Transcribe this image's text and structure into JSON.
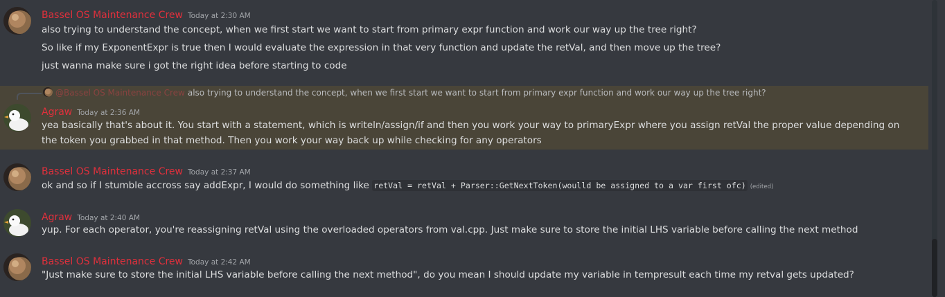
{
  "messages": [
    {
      "author": "Bassel OS Maintenance Crew",
      "timestamp": "Today at 2:30 AM",
      "lines": [
        "also trying to understand the concept, when we first start we want to start from primary expr function and work our way up the tree right?",
        "So like if my ExponentExpr is true then I would evaluate the expression in that very function and update the retVal, and then move up the tree?",
        "just wanna make sure i got the right idea before starting to code"
      ]
    },
    {
      "reply": {
        "mention": "@Bassel OS Maintenance Crew",
        "text": "also trying to understand the concept, when we first start we want to start from primary expr function and work our way up the tree right?"
      },
      "author": "Agraw",
      "timestamp": "Today at 2:36 AM",
      "text": "yea basically that's about it. You start with a statement, which is writeln/assign/if and then you work your way to primaryExpr where you assign retVal the proper value depending on the token you grabbed in that method. Then you work your way back up while checking for any operators"
    },
    {
      "author": "Bassel OS Maintenance Crew",
      "timestamp": "Today at 2:37 AM",
      "text_before": "ok and so if I stumble accross say addExpr, I would do something like ",
      "code": "retVal = retVal + Parser::GetNextToken(woulld be assigned to a var first ofc)",
      "edited": "(edited)"
    },
    {
      "author": "Agraw",
      "timestamp": "Today at 2:40 AM",
      "text": "yup. For each operator, you're reassigning retVal using the overloaded operators from val.cpp. Just make sure to store the initial LHS variable before calling the next method"
    },
    {
      "author": "Bassel OS Maintenance Crew",
      "timestamp": "Today at 2:42 AM",
      "text": "\"Just make sure to store the initial LHS variable before calling the next method\", do you mean I should update my variable in tempresult each time my retval gets updated?"
    }
  ],
  "colors": {
    "background": "#36393f",
    "author_name": "#e0303c",
    "highlight": "#4a4538",
    "text": "#dcddde",
    "timestamp": "#a3a6aa"
  },
  "icons": {
    "bassel_avatar": "planet-avatar-icon",
    "agraw_avatar": "duck-avatar-icon"
  }
}
